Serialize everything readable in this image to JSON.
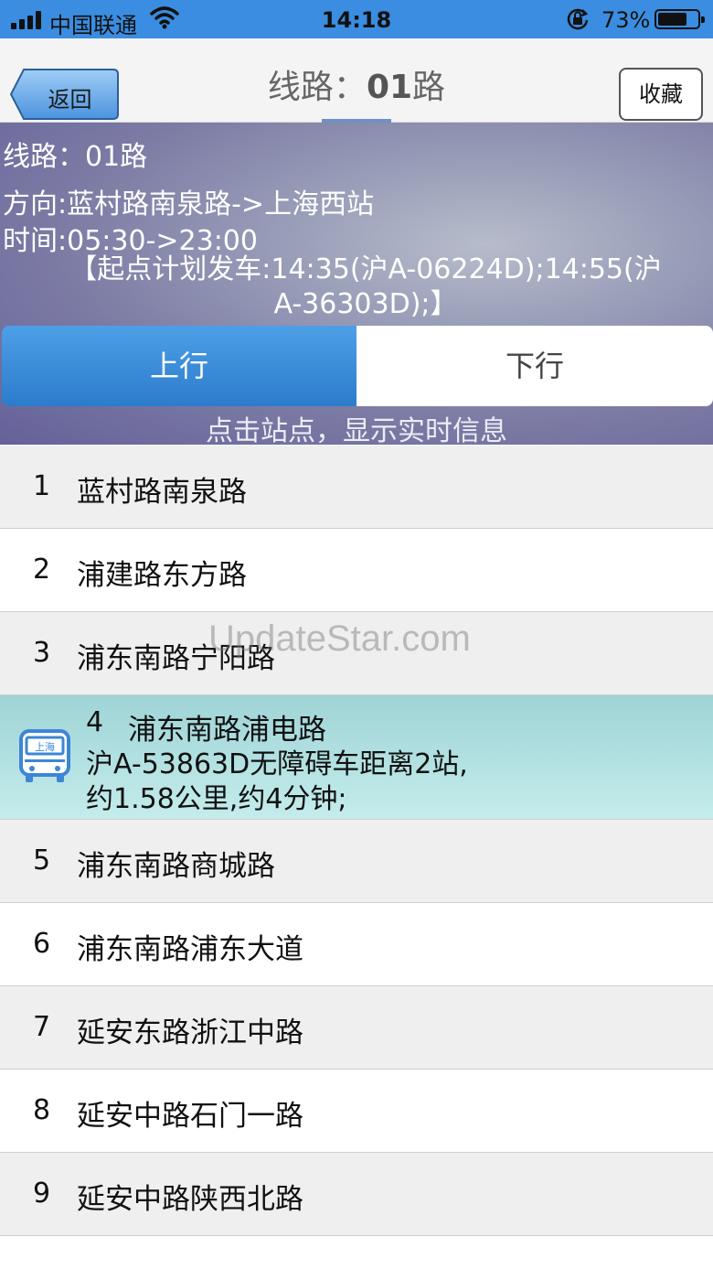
{
  "status_bar": {
    "carrier": "中国联通",
    "time": "14:18",
    "battery_percent": "73%",
    "battery_level": 0.73
  },
  "nav": {
    "back_label": "返回",
    "title_prefix": "线路：",
    "title_route": "01",
    "title_suffix": "路",
    "favorite_label": "收藏"
  },
  "info": {
    "route_line": "线路：01路",
    "direction_line": "方向:蓝村路南泉路->上海西站",
    "time_line": "时间:05:30->23:00",
    "plan_line1": "【起点计划发车:14:35(沪A-06224D);14:55(沪",
    "plan_line2": "A-36303D);】"
  },
  "direction_tabs": {
    "up_label": "上行",
    "down_label": "下行",
    "selected": "上行"
  },
  "hint": "点击站点，显示实时信息",
  "stations": [
    {
      "num": "1",
      "name": "蓝村路南泉路"
    },
    {
      "num": "2",
      "name": "浦建路东方路"
    },
    {
      "num": "3",
      "name": "浦东南路宁阳路"
    },
    {
      "num": "4",
      "name": "浦东南路浦电路",
      "realtime_line1": "沪A-53863D无障碍车距离2站,",
      "realtime_line2": "约1.58公里,约4分钟;"
    },
    {
      "num": "5",
      "name": "浦东南路商城路"
    },
    {
      "num": "6",
      "name": "浦东南路浦东大道"
    },
    {
      "num": "7",
      "name": "延安东路浙江中路"
    },
    {
      "num": "8",
      "name": "延安中路石门一路"
    },
    {
      "num": "9",
      "name": "延安中路陕西北路"
    }
  ],
  "bus_icon_text": "上海",
  "watermark": "UpdateStar.com",
  "colors": {
    "accent": "#3a8de0",
    "active_row": "#b3e2e2",
    "header_bg": "#7c7ba4"
  }
}
